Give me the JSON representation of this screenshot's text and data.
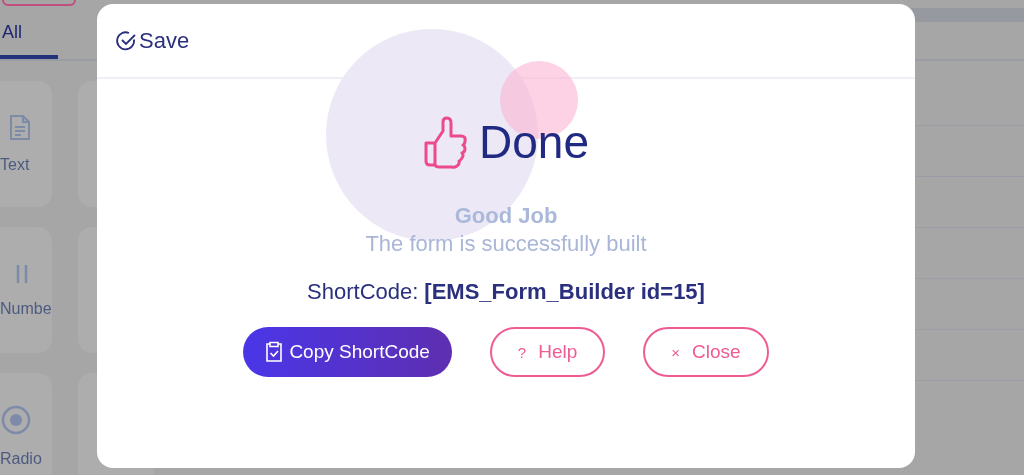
{
  "background": {
    "tabs": [
      {
        "label": "All",
        "selected": true
      }
    ],
    "tiles": [
      {
        "label": "Text",
        "kind": "doc"
      },
      {
        "label": "Numbe",
        "kind": "number"
      },
      {
        "label": "Radio",
        "kind": "radio"
      }
    ]
  },
  "dialog": {
    "save": "Save",
    "title": "Done",
    "heading": "Good Job",
    "message": "The form is successfully built",
    "shortcode_label": "ShortCode:",
    "shortcode": "[EMS_Form_Builder id=15]",
    "buttons": [
      {
        "label": "Copy ShortCode",
        "kind": "primary"
      },
      {
        "label": "Help",
        "kind": "outline",
        "glyph": "?"
      },
      {
        "label": "Close",
        "kind": "outline",
        "glyph": "×"
      }
    ]
  }
}
